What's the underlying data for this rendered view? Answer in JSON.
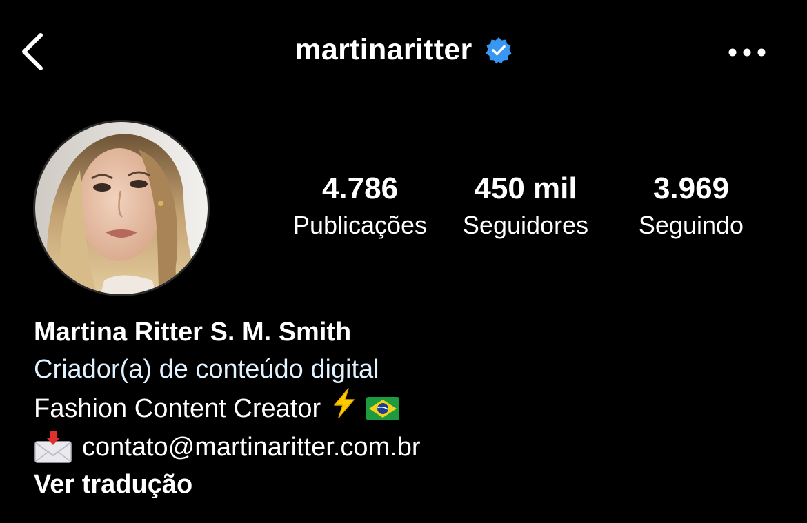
{
  "header": {
    "username": "martinaritter",
    "back_icon": "chevron-left-icon",
    "verified_icon": "verified-badge-icon",
    "more_icon": "more-horizontal-icon"
  },
  "profile": {
    "avatar_icon": "profile-photo",
    "stats": [
      {
        "value": "4.786",
        "label": "Publicações"
      },
      {
        "value": "450 mil",
        "label": "Seguidores"
      },
      {
        "value": "3.969",
        "label": "Seguindo"
      }
    ]
  },
  "bio": {
    "name": "Martina Ritter S. M. Smith",
    "category": "Criador(a) de conteúdo digital",
    "description": "Fashion Content Creator",
    "description_emoji": "⚡",
    "email": "contato@martinaritter.com.br",
    "translate_label": "Ver tradução"
  },
  "colors": {
    "background": "#000000",
    "text": "#ffffff",
    "category": "#e0f1ff",
    "verified": "#3897f0"
  }
}
